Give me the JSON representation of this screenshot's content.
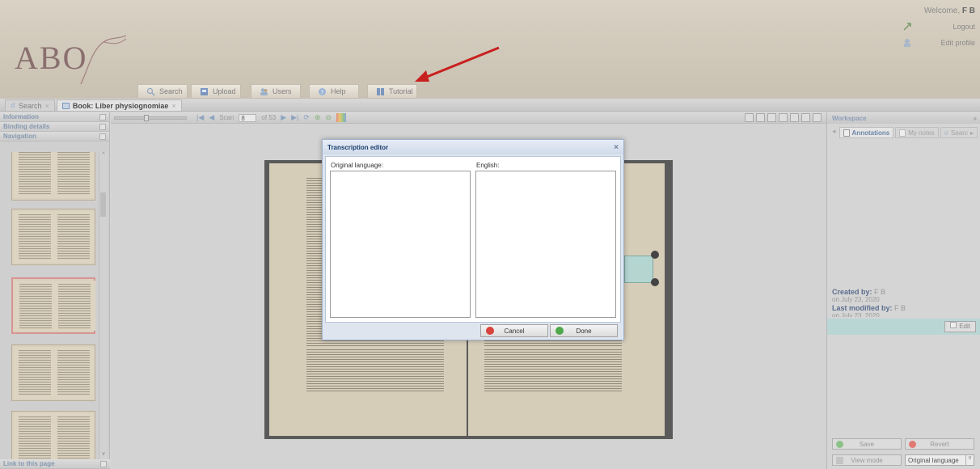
{
  "header": {
    "logo_text": "ABO",
    "welcome_prefix": "Welcome,",
    "welcome_user": "F B",
    "logout_label": "Logout",
    "edit_profile_label": "Edit profile"
  },
  "main_nav": [
    {
      "label": "Search",
      "icon": "search-icon"
    },
    {
      "label": "Upload",
      "icon": "upload-icon"
    },
    {
      "label": "Users",
      "icon": "users-icon"
    },
    {
      "label": "Help",
      "icon": "help-icon"
    },
    {
      "label": "Tutorial",
      "icon": "tutorial-icon"
    }
  ],
  "tabs": [
    {
      "label": "Search",
      "active": false
    },
    {
      "label": "Book: Liber physiognomiae",
      "active": true
    }
  ],
  "left_panel": {
    "information": "Information",
    "binding_details": "Binding details",
    "navigation": "Navigation",
    "link_to_page": "Link to this page"
  },
  "viewer": {
    "scan_label": "Scan",
    "scan_value": "8",
    "scan_total": "of 53"
  },
  "dialog": {
    "title": "Transcription editor",
    "original_label": "Original language:",
    "english_label": "English:",
    "cancel_label": "Cancel",
    "done_label": "Done"
  },
  "workspace": {
    "title": "Workspace",
    "tabs": [
      "Annotations",
      "My notes",
      "Searc"
    ],
    "created_by_label": "Created by:",
    "created_by_value": "F B",
    "created_on": "on July 23, 2020",
    "modified_by_label": "Last modified by:",
    "modified_by_value": "F B",
    "modified_on": "on July 23, 2020",
    "edit_label": "Edit",
    "save_label": "Save",
    "revert_label": "Revert",
    "view_mode_label": "View mode",
    "language_select": "Original language"
  },
  "colors": {
    "arrow": "#c8201e",
    "annotation": "#b5d6d0",
    "selected_thumb_border": "#d99393"
  }
}
